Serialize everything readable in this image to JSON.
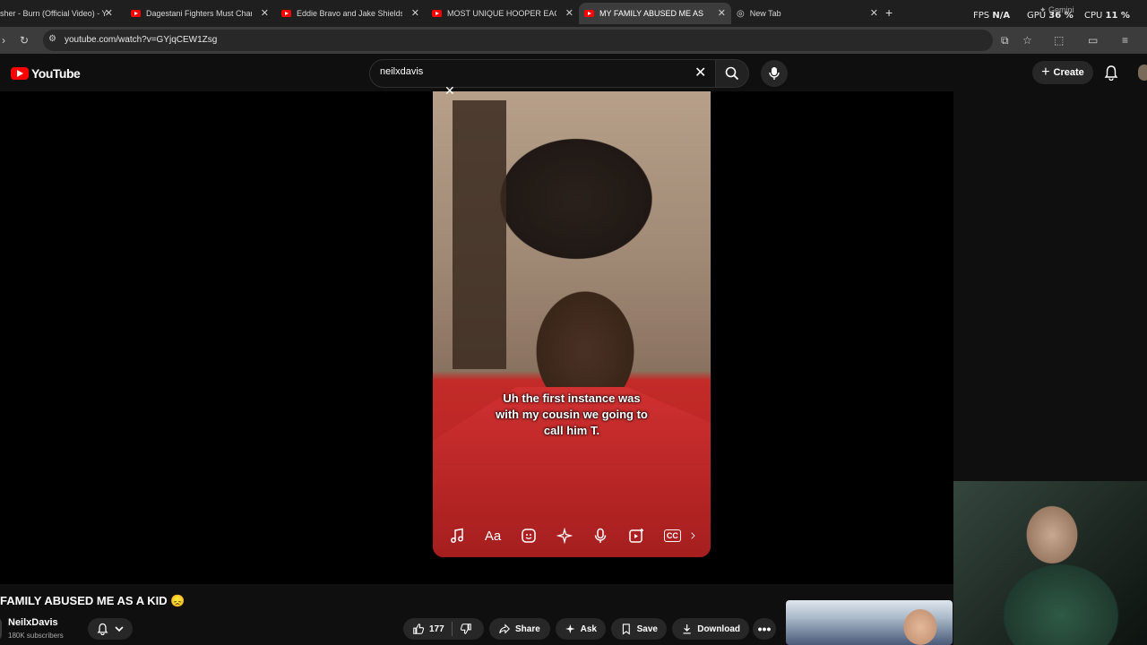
{
  "browser": {
    "tabs": [
      {
        "title": "sher - Burn (Official Video) - Y",
        "active": false
      },
      {
        "title": "Dagestani Fighters Must Chang",
        "active": false
      },
      {
        "title": "Eddie Bravo and Jake Shields D",
        "active": false
      },
      {
        "title": "MOST UNIQUE HOOPER EACH",
        "active": false
      },
      {
        "title": "MY FAMILY ABUSED ME AS A K",
        "active": true
      },
      {
        "title": "New Tab",
        "active": false
      }
    ],
    "url": "youtube.com/watch?v=GYjqCEW1Zsg",
    "perf": {
      "fps_label": "FPS",
      "fps_value": "N/A",
      "gpu_label": "GPU",
      "gpu_value": "36 %",
      "cpu_label": "CPU",
      "cpu_value": "11 %"
    },
    "gemini_label": "Gemini"
  },
  "youtube": {
    "logo_text": "YouTube",
    "search_value": "neilxdavis",
    "create_label": "Create"
  },
  "video": {
    "caption_line1": "Uh the first instance was",
    "caption_line2": "with my cousin we going to",
    "caption_line3": "call him T.",
    "toolbar_icons": [
      "music-note-icon",
      "text-aa-icon",
      "sticker-icon",
      "sparkle-icon",
      "microphone-icon",
      "add-clip-icon",
      "closed-captions-icon",
      "more-partial-icon"
    ],
    "aa_label": "Aa",
    "cc_label": "CC"
  },
  "info": {
    "title": "FAMILY ABUSED ME AS A KID 😞",
    "channel": "NeilxDavis",
    "subscribers": "180K subscribers",
    "likes": "177",
    "share_label": "Share",
    "ask_label": "Ask",
    "save_label": "Save",
    "download_label": "Download"
  }
}
